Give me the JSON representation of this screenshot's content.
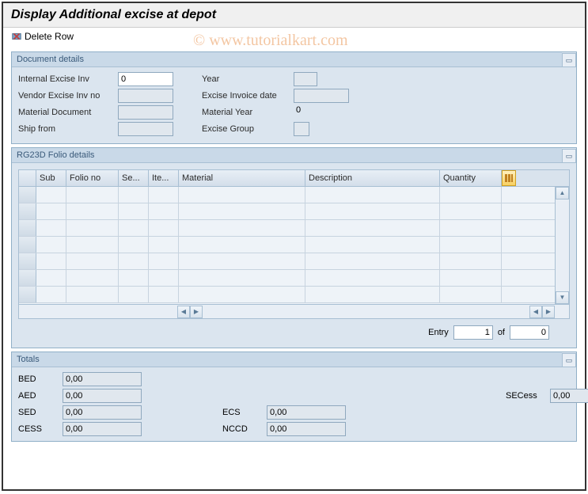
{
  "title": "Display Additional excise at depot",
  "toolbar": {
    "delete_row": "Delete Row"
  },
  "watermark": "© www.tutorialkart.com",
  "doc": {
    "panel_title": "Document details",
    "internal_lbl": "Internal Excise Inv",
    "internal_val": "0",
    "year_lbl": "Year",
    "year_val": "",
    "vendor_lbl": "Vendor Excise Inv no",
    "vendor_val": "",
    "invdate_lbl": "Excise Invoice date",
    "invdate_val": "",
    "matdoc_lbl": "Material Document",
    "matdoc_val": "",
    "matyear_lbl": "Material Year",
    "matyear_val": "0",
    "ship_lbl": "Ship from",
    "ship_val": "",
    "exgrp_lbl": "Excise Group",
    "exgrp_val": ""
  },
  "folio": {
    "panel_title": "RG23D Folio details",
    "cols": {
      "sub": "Sub",
      "folio": "Folio no",
      "se": "Se...",
      "ite": "Ite...",
      "mat": "Material",
      "desc": "Description",
      "qty": "Quantity"
    },
    "entry_lbl": "Entry",
    "entry_val": "1",
    "of_lbl": "of",
    "of_val": "0"
  },
  "totals": {
    "panel_title": "Totals",
    "bed_lbl": "BED",
    "bed_val": "0,00",
    "aed_lbl": "AED",
    "aed_val": "0,00",
    "sed_lbl": "SED",
    "sed_val": "0,00",
    "cess_lbl": "CESS",
    "cess_val": "0,00",
    "ecs_lbl": "ECS",
    "ecs_val": "0,00",
    "nccd_lbl": "NCCD",
    "nccd_val": "0,00",
    "secess_lbl": "SECess",
    "secess_val": "0,00"
  }
}
